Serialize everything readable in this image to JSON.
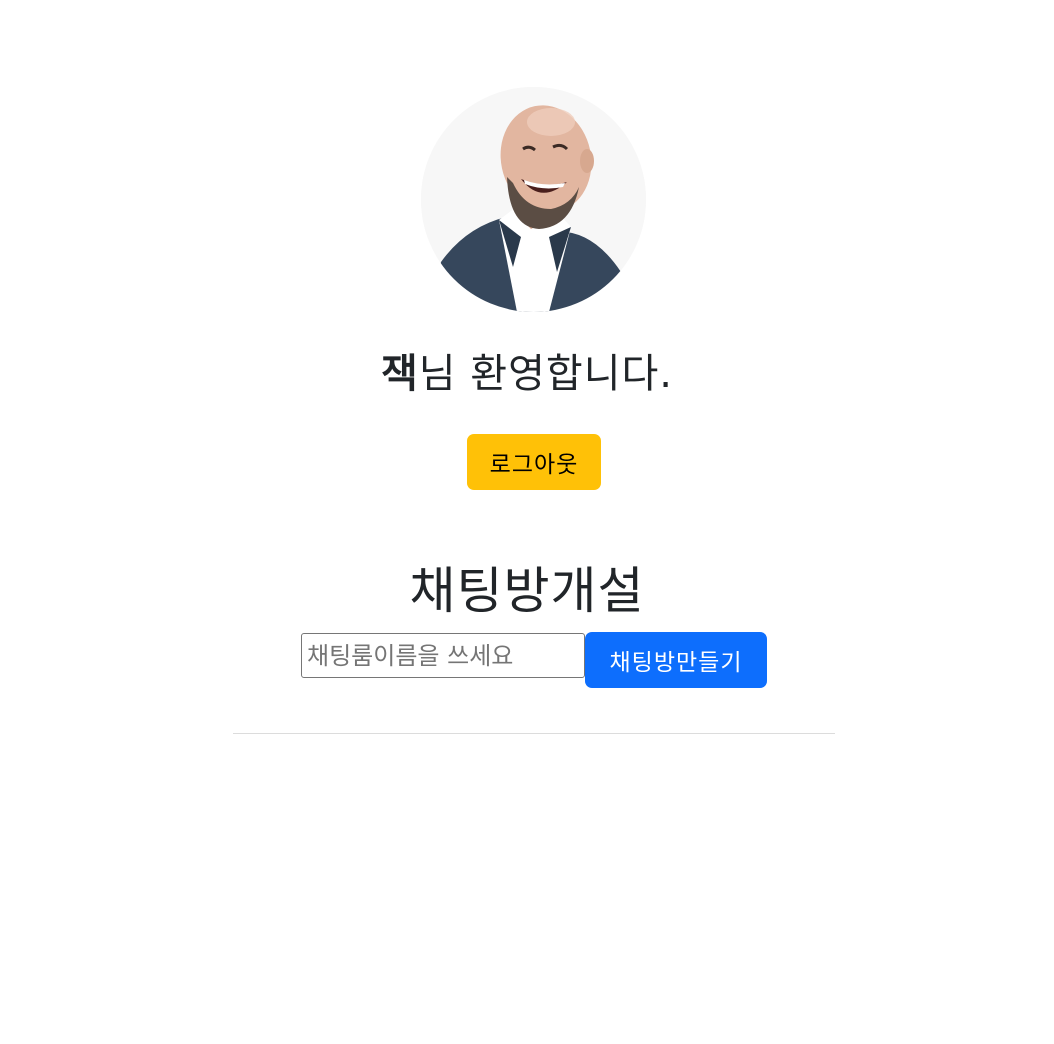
{
  "profile": {
    "avatar_alt": "profile photo",
    "user_name": "잭",
    "greeting_suffix": "님 환영합니다."
  },
  "actions": {
    "logout_label": "로그아웃"
  },
  "create_room": {
    "title": "채팅방개설",
    "input_placeholder": "채팅룸이름을 쓰세요",
    "input_value": "",
    "submit_label": "채팅방만들기"
  },
  "room_list": {
    "items": []
  },
  "colors": {
    "logout_button": "#ffc107",
    "create_button": "#0d6efd",
    "text": "#212529",
    "divider": "#dcdcdc"
  }
}
